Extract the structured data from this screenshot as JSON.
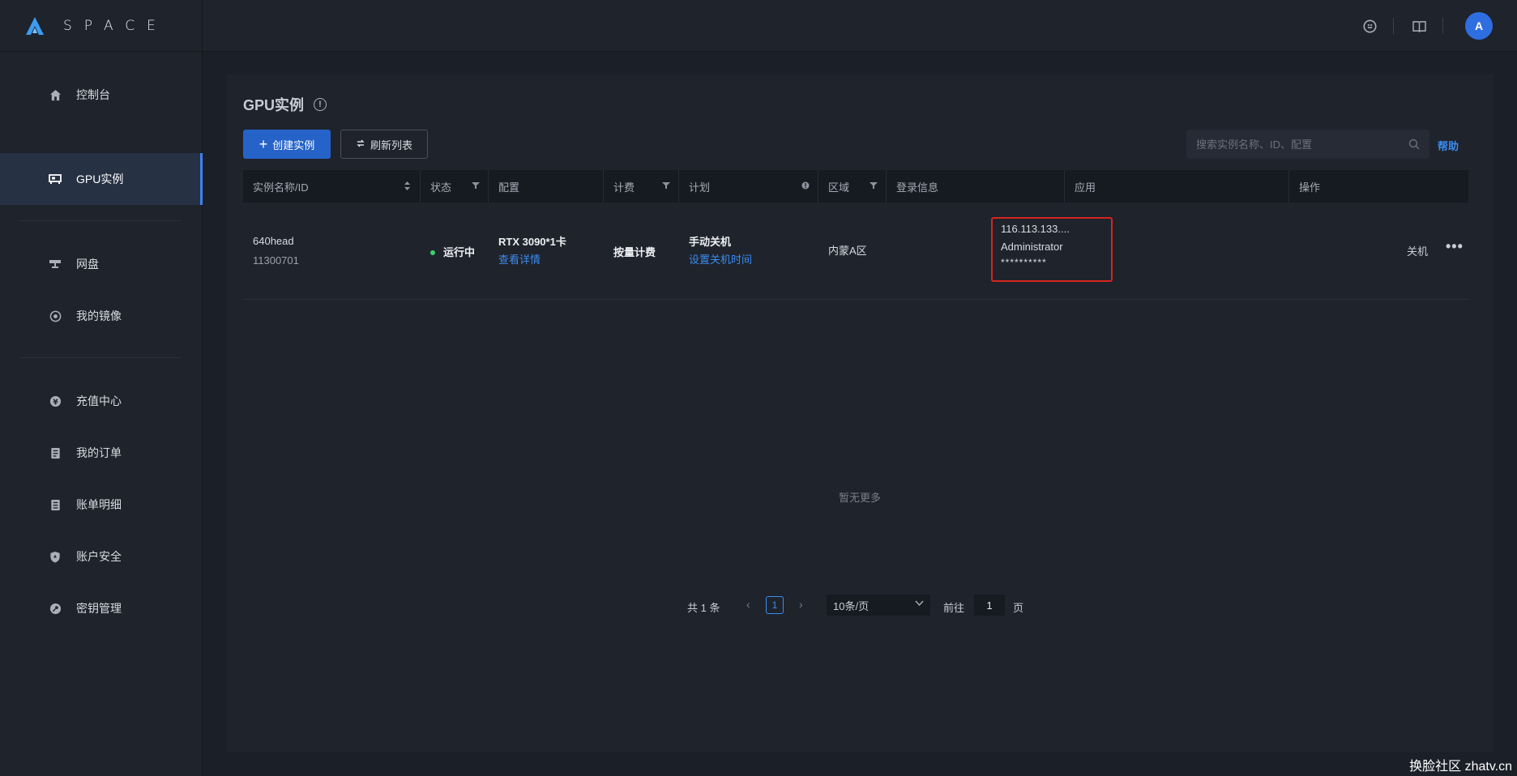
{
  "app": {
    "name": "SPACE"
  },
  "sidebar": {
    "items": [
      {
        "label": "控制台",
        "icon": "home-icon"
      },
      {
        "label": "GPU实例",
        "icon": "gpu-icon",
        "active": true
      },
      {
        "label": "网盘",
        "icon": "disk-icon"
      },
      {
        "label": "我的镜像",
        "icon": "image-icon"
      },
      {
        "label": "充值中心",
        "icon": "recharge-icon"
      },
      {
        "label": "我的订单",
        "icon": "order-icon"
      },
      {
        "label": "账单明细",
        "icon": "bill-icon"
      },
      {
        "label": "账户安全",
        "icon": "shield-icon"
      },
      {
        "label": "密钥管理",
        "icon": "key-icon"
      }
    ]
  },
  "topbar": {
    "avatar_letter": "A"
  },
  "page": {
    "title": "GPU实例",
    "create_label": "创建实例",
    "refresh_label": "刷新列表",
    "search_placeholder": "搜索实例名称、ID、配置",
    "help_label": "帮助"
  },
  "table": {
    "headers": [
      "实例名称/ID",
      "状态",
      "配置",
      "计费",
      "计划",
      "区域",
      "登录信息",
      "应用",
      "操作"
    ],
    "rows": [
      {
        "name": "640head",
        "id": "11300701",
        "status": "运行中",
        "config": "RTX 3090*1卡",
        "config_link": "查看详情",
        "billing": "按量计费",
        "plan": "手动关机",
        "plan_link": "设置关机时间",
        "region": "内蒙A区",
        "login_ip": "116.113.133....",
        "login_user": "Administrator",
        "login_password": "**********",
        "op_shutdown": "关机",
        "op_more": "•••"
      }
    ],
    "empty_text": "暂无更多"
  },
  "pagination": {
    "total": "共 1 条",
    "current_page": "1",
    "page_size": "10条/页",
    "goto_label": "前往",
    "goto_value": "1",
    "goto_unit": "页"
  },
  "watermark": "换脸社区 zhatv.cn",
  "colors": {
    "accent": "#2563c9",
    "link": "#3b8cf0",
    "running": "#3ad36b",
    "highlight_border": "#d8251f"
  }
}
